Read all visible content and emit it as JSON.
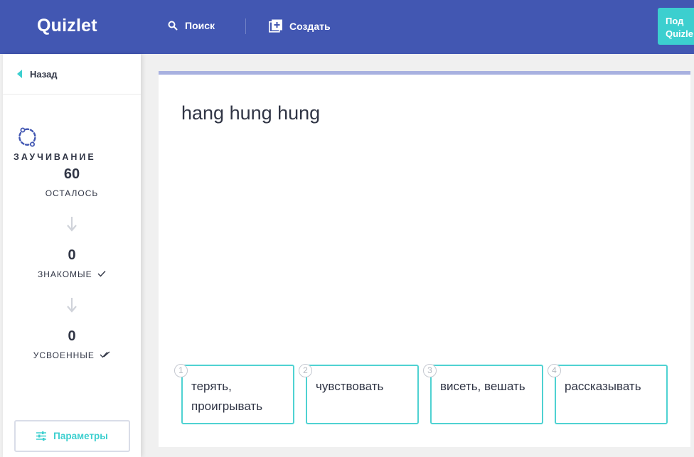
{
  "header": {
    "logo": "Quizlet",
    "search_label": "Поиск",
    "create_label": "Создать",
    "upgrade_line1": "Под",
    "upgrade_line2": "Quizle",
    "colors": {
      "bar": "#4257b2",
      "upgrade": "#3ccfcf"
    }
  },
  "sidebar": {
    "back_label": "Назад",
    "mode_title": "ЗАУЧИВАНИЕ",
    "remaining_count": "60",
    "remaining_label": "ОСТАЛОСЬ",
    "familiar_count": "0",
    "familiar_label": "ЗНАКОМЫЕ",
    "mastered_count": "0",
    "mastered_label": "УСВОЕННЫЕ",
    "params_label": "Параметры"
  },
  "question": {
    "prompt": "hang hung hung",
    "progress_fraction": 0,
    "options": [
      {
        "number": "1",
        "text": "терять, проигрывать"
      },
      {
        "number": "2",
        "text": "чувствовать"
      },
      {
        "number": "3",
        "text": "висеть, вешать"
      },
      {
        "number": "4",
        "text": "рассказывать"
      }
    ]
  }
}
